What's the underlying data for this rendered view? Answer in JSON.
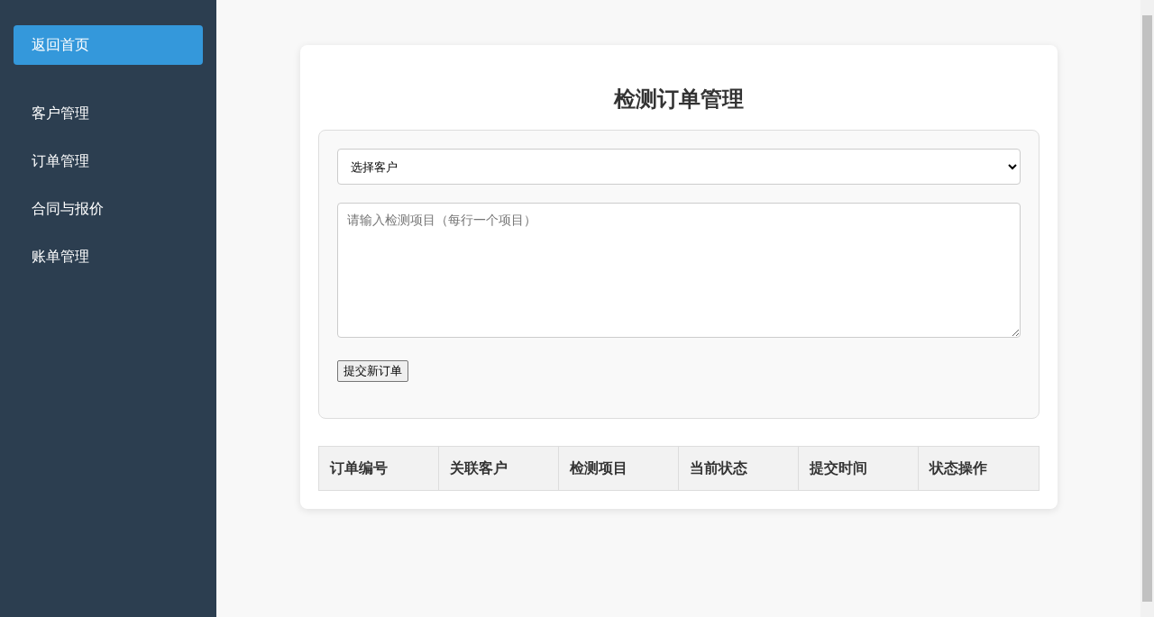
{
  "sidebar": {
    "home_button": "返回首页",
    "items": [
      {
        "label": "客户管理"
      },
      {
        "label": "订单管理"
      },
      {
        "label": "合同与报价"
      },
      {
        "label": "账单管理"
      }
    ]
  },
  "main": {
    "title": "检测订单管理",
    "form": {
      "customer_select": {
        "value": "选择客户"
      },
      "items_field": {
        "placeholder": "请输入检测项目（每行一个项目）"
      },
      "submit_button": "提交新订单"
    },
    "table": {
      "columns": [
        "订单编号",
        "关联客户",
        "检测项目",
        "当前状态",
        "提交时间",
        "状态操作"
      ]
    }
  }
}
